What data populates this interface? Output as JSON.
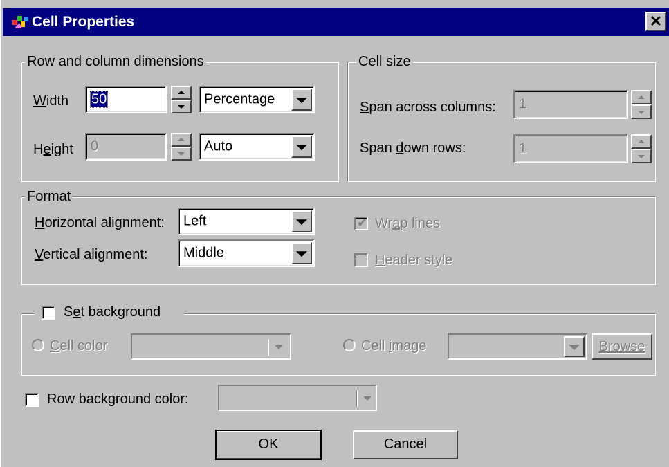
{
  "window": {
    "title": "Cell Properties",
    "close_glyph": "✕",
    "app_icon": "app-icon"
  },
  "row_col": {
    "legend": "Row and column dimensions",
    "width_label": "Width",
    "width_value": "50",
    "width_unit": "Percentage",
    "height_label": "Height",
    "height_value": "0",
    "height_unit": "Auto"
  },
  "cell_size": {
    "legend": "Cell size",
    "span_cols_label": "Span across columns:",
    "span_cols_value": "1",
    "span_rows_label": "Span down rows:",
    "span_rows_value": "1"
  },
  "format": {
    "legend": "Format",
    "h_align_label": "Horizontal alignment:",
    "h_align_value": "Left",
    "v_align_label": "Vertical alignment:",
    "v_align_value": "Middle",
    "wrap_lines_label": "Wrap lines",
    "wrap_lines_checked": true,
    "header_style_label": "Header style",
    "header_style_checked": false
  },
  "background": {
    "set_bg_label": "Set background",
    "cell_color_label": "Cell color",
    "cell_image_label": "Cell image",
    "browse_label": "Browse",
    "row_bg_label": "Row background color:"
  },
  "buttons": {
    "ok": "OK",
    "cancel": "Cancel"
  },
  "colors": {
    "titlebar": "#000080",
    "face": "#c0c0c0",
    "disabled_text": "#808080"
  }
}
